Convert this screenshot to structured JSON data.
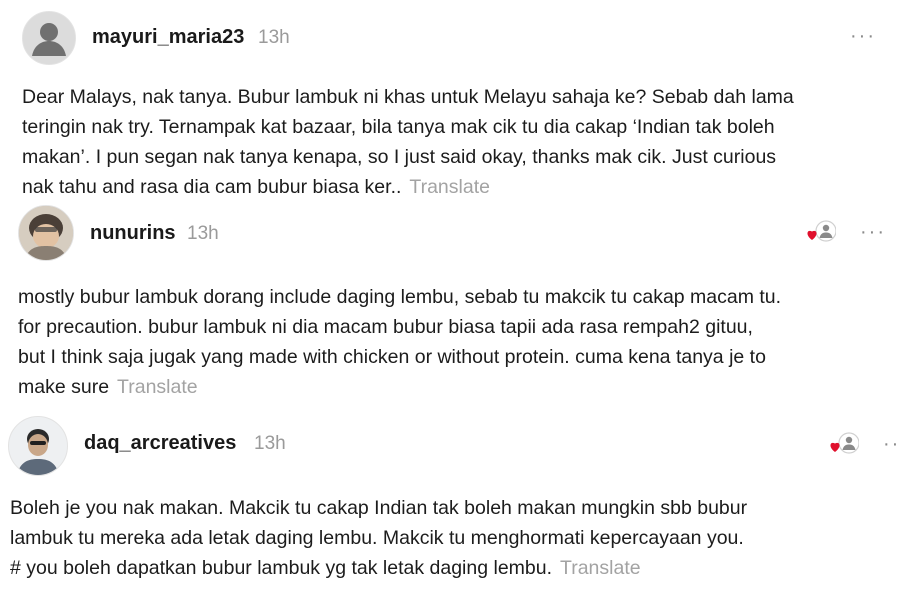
{
  "comments": [
    {
      "username": "mayuri_maria23",
      "time": "13h",
      "more_label": "···",
      "lines": [
        "Dear Malays, nak tanya. Bubur lambuk ni khas untuk Melayu sahaja ke? Sebab dah lama",
        "teringin nak try. Ternampak kat bazaar, bila tanya mak cik tu dia cakap ‘Indian tak boleh",
        "makan’. I pun segan nak tanya kenapa, so I just said okay, thanks mak cik. Just curious",
        "nak tahu and rasa dia cam bubur biasa ker.."
      ],
      "translate": "Translate",
      "avatar_icon": "default-user-icon"
    },
    {
      "username": "nunurins",
      "time": "13h",
      "more_label": "···",
      "lines": [
        "mostly bubur lambuk dorang include daging lembu, sebab tu makcik tu cakap macam tu.",
        "for precaution. bubur lambuk ni dia macam bubur biasa tapii ada rasa rempah2 gituu,",
        "but I think saja jugak yang made with chicken or without protein. cuma kena tanya je to",
        "make sure"
      ],
      "translate": "Translate",
      "like_icon": "liked-by-author-icon"
    },
    {
      "username": "daq_arcreatives",
      "time": "13h",
      "more_label": "··",
      "lines": [
        "Boleh je you nak makan. Makcik tu cakap Indian tak boleh makan mungkin sbb bubur",
        "lambuk tu mereka ada letak daging lembu. Makcik tu menghormati kepercayaan you.",
        "# you boleh dapatkan bubur lambuk yg tak letak daging lembu."
      ],
      "translate": "Translate",
      "like_icon": "liked-by-author-icon"
    }
  ],
  "colors": {
    "heart": "#e0102d",
    "muted": "#9a9a9a",
    "text": "#1c1c1c"
  }
}
